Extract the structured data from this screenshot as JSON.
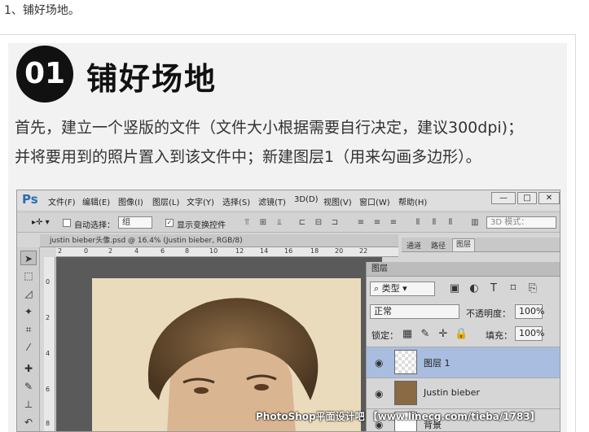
{
  "step": "1、铺好场地。",
  "badge": "01",
  "heading": "铺好场地",
  "paragraph": {
    "line1": "首先，建立一个竖版的文件（文件大小根据需要自行决定，建议300dpi)；",
    "line2": "并将要用到的照片置入到该文件中；新建图层1（用来勾画多边形）。"
  },
  "ps": {
    "logo": "Ps",
    "menus": [
      "文件(F)",
      "编辑(E)",
      "图像(I)",
      "图层(L)",
      "文字(Y)",
      "选择(S)",
      "滤镜(T)",
      "3D(D)",
      "视图(V)",
      "窗口(W)",
      "帮助(H)"
    ],
    "window_buttons": [
      "—",
      "□",
      "✕"
    ],
    "options": {
      "auto_select_label": "自动选择：",
      "auto_select_value": "组",
      "show_transform_label": "显示变换控件",
      "mode_3d": "3D 模式："
    },
    "doc_tab": "justin bieber头像.psd @ 16.4% (Justin bieber, RGB/8)",
    "ruler_h_ticks": [
      "2",
      "0",
      "2",
      "4",
      "6",
      "8",
      "10",
      "12",
      "14",
      "16",
      "18",
      "20",
      "22"
    ],
    "ruler_v_ticks": [
      "0",
      "2",
      "4",
      "6",
      "8"
    ],
    "panel_tabs": [
      "通道",
      "路径",
      "图层"
    ],
    "layers": {
      "title": "图层",
      "filter_kind": "类型",
      "blend_mode": "正常",
      "opacity_label": "不透明度：",
      "opacity_value": "100%",
      "lock_label": "锁定：",
      "fill_label": "填充：",
      "fill_value": "100%",
      "rows": [
        {
          "name": "图层 1",
          "selected": true
        },
        {
          "name": "Justin bieber",
          "selected": false
        },
        {
          "name": "背景",
          "selected": false
        }
      ]
    }
  },
  "watermark": "PhotoShop平面设计吧 【www.linecg.com/tieba/1783】"
}
